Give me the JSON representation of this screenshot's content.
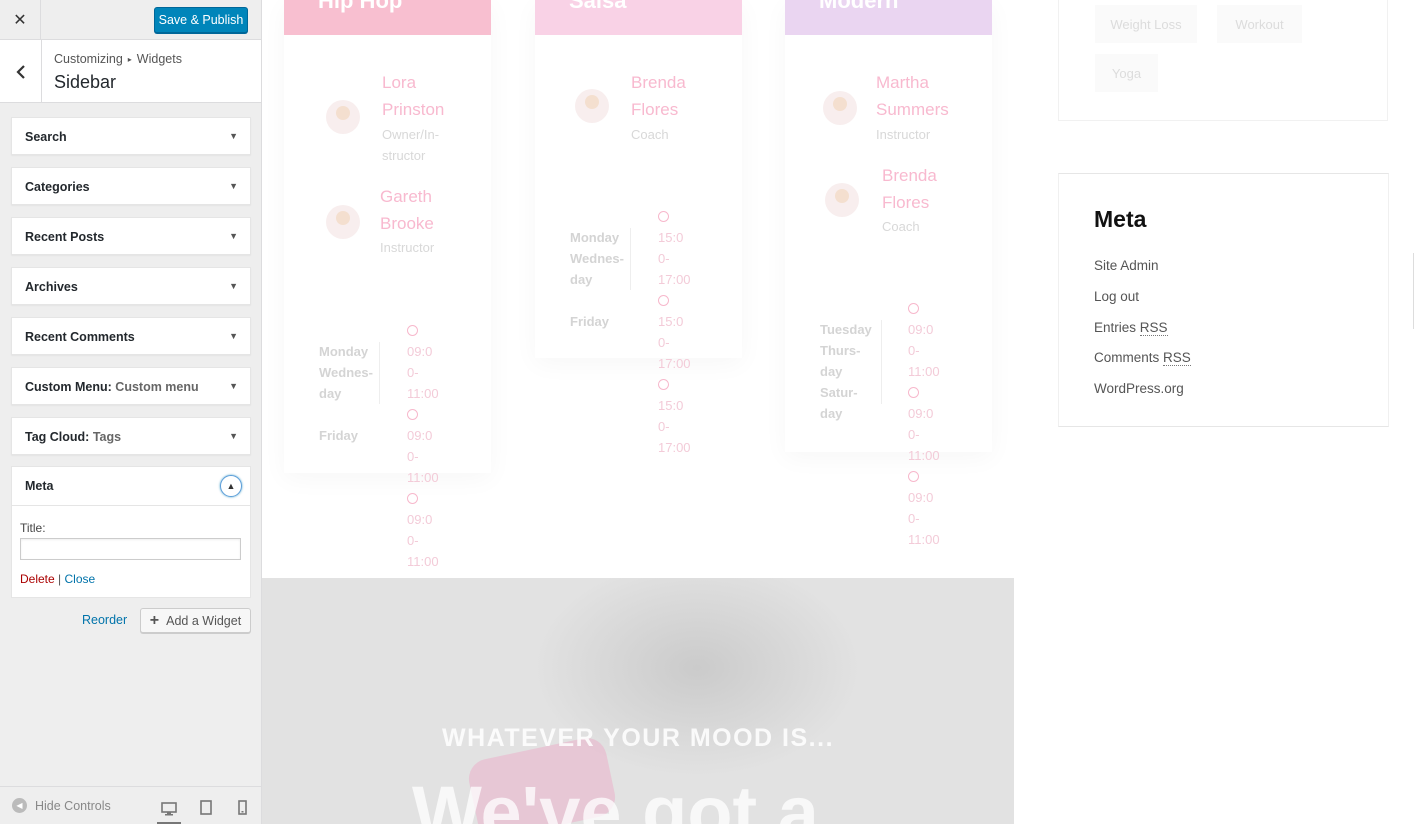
{
  "header": {
    "close_icon": "close-icon",
    "save_label": "Save & Publish"
  },
  "section": {
    "crumb_root": "Customizing",
    "crumb_child": "Widgets",
    "title": "Sidebar"
  },
  "widgets": [
    {
      "label": "Search",
      "instance": ""
    },
    {
      "label": "Categories",
      "instance": ""
    },
    {
      "label": "Recent Posts",
      "instance": ""
    },
    {
      "label": "Archives",
      "instance": ""
    },
    {
      "label": "Recent Comments",
      "instance": ""
    },
    {
      "label": "Custom Menu:",
      "instance": "Custom menu"
    },
    {
      "label": "Tag Cloud:",
      "instance": "Tags"
    }
  ],
  "meta_widget": {
    "label": "Meta",
    "title_label": "Title:",
    "title_value": "",
    "delete_label": "Delete",
    "separator": "|",
    "close_label": "Close"
  },
  "actions": {
    "reorder_label": "Reorder",
    "add_label": "Add a Widget"
  },
  "footer": {
    "hide_label": "Hide Controls"
  },
  "preview": {
    "classes": [
      {
        "name": "Hip Hop",
        "color": "#f8bfd0",
        "people": [
          {
            "first": "Lora",
            "last": "Prinston",
            "role1": "Owner/In-",
            "role2": "structor"
          },
          {
            "first": "Gareth",
            "last": "Brooke",
            "role1": "Instructor",
            "role2": ""
          }
        ],
        "days": [
          "Monday",
          "Wednes-",
          "day",
          "",
          "Friday"
        ],
        "times": [
          "09:0",
          "0-11:00",
          "09:0",
          "0-11:00",
          "09:0",
          "0-11:00"
        ]
      },
      {
        "name": "Salsa",
        "color": "#f9d2e6",
        "people": [
          {
            "first": "Brenda",
            "last": "Flores",
            "role1": "Coach",
            "role2": ""
          }
        ],
        "days": [
          "Monday",
          "Wednes-",
          "day",
          "",
          "Friday"
        ],
        "times": [
          "15:0",
          "0-17:00",
          "15:0",
          "0-17:00",
          "15:0",
          "0-17:00"
        ]
      },
      {
        "name": "Modern",
        "color": "#ead5f1",
        "people": [
          {
            "first": "Martha",
            "last": "Summers",
            "role1": "Instructor",
            "role2": ""
          },
          {
            "first": "Brenda",
            "last": "Flores",
            "role1": "Coach",
            "role2": ""
          }
        ],
        "days": [
          "Tuesday",
          "Thurs-",
          "day",
          "Satur-",
          "day"
        ],
        "times": [
          "09:0",
          "0-11:00",
          "09:0",
          "0-11:00",
          "09:0",
          "0-11:00"
        ]
      }
    ],
    "hero": {
      "tagline": "WHATEVER YOUR MOOD IS...",
      "headline": "We've got a"
    },
    "tags": [
      "Weight Loss",
      "Workout",
      "Yoga"
    ],
    "meta": {
      "heading": "Meta",
      "links": [
        "Site Admin",
        "Log out",
        "Entries",
        "Comments",
        "WordPress.org"
      ],
      "rss": "RSS"
    }
  }
}
